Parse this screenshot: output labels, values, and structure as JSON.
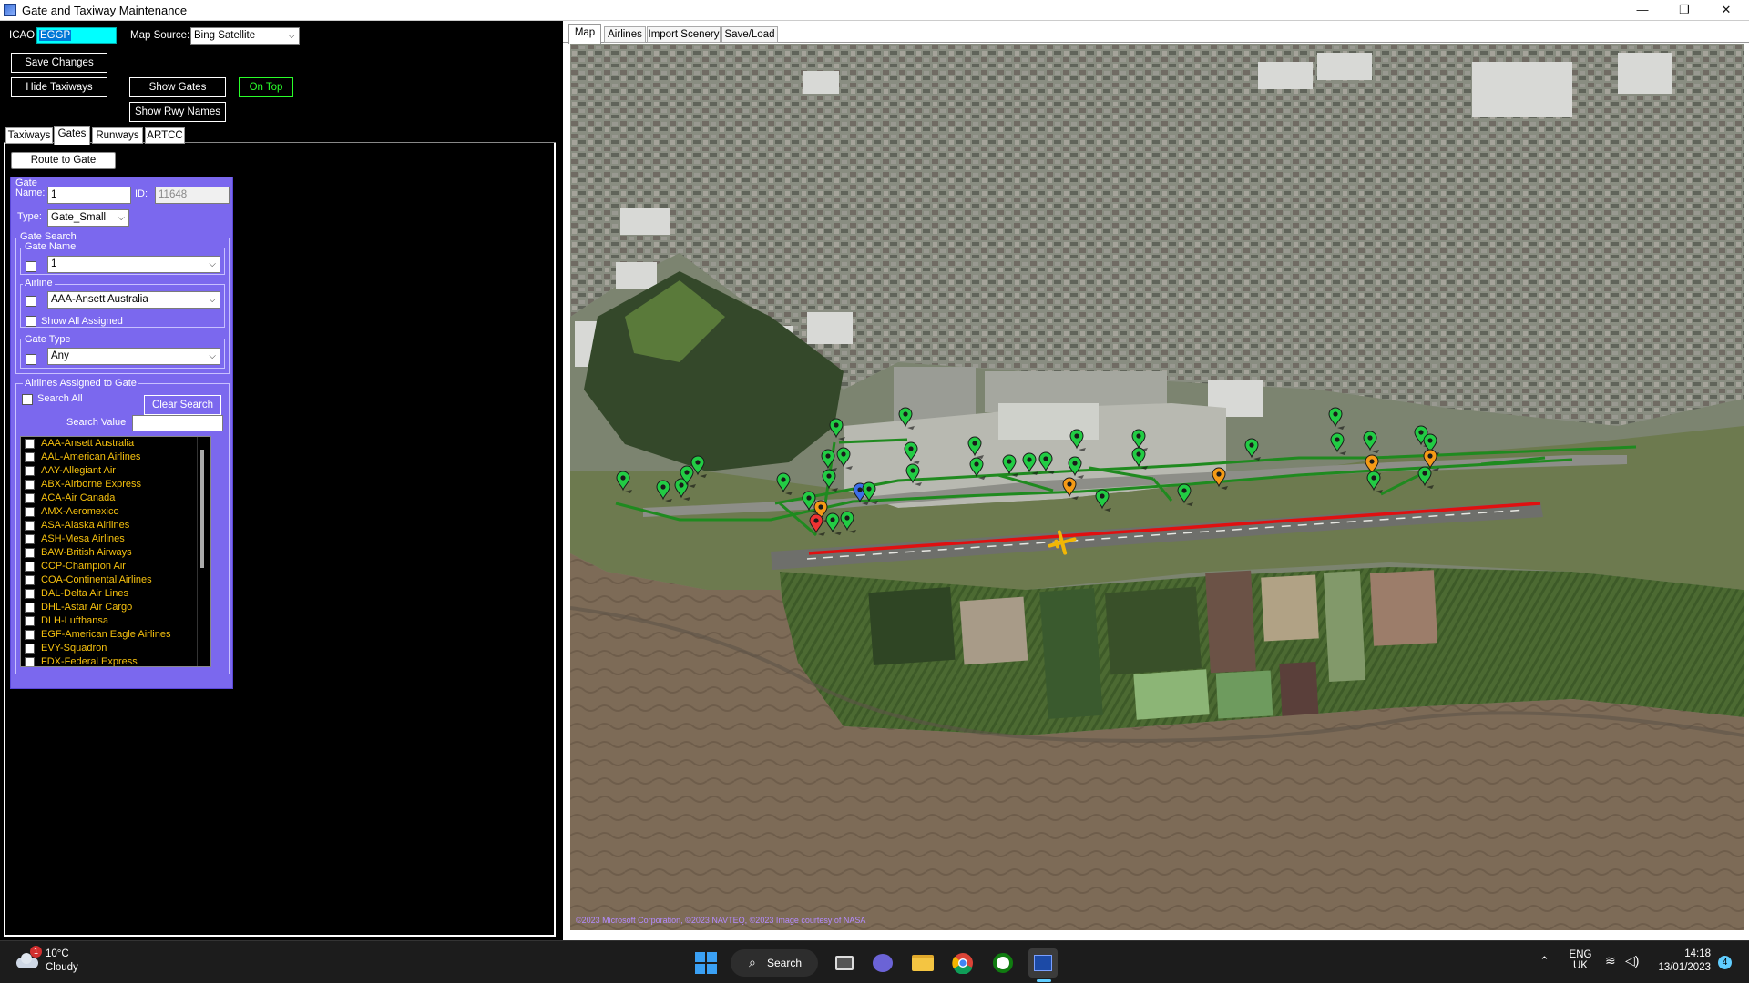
{
  "window": {
    "title": "Gate and Taxiway Maintenance",
    "controls": [
      "—",
      "❐",
      "✕"
    ]
  },
  "toolbar": {
    "icao_label": "ICAO:",
    "icao_value": "EGGP",
    "map_source_label": "Map Source:",
    "map_source_value": "Bing Satellite",
    "save_changes": "Save Changes",
    "hide_taxiways": "Hide Taxiways",
    "show_gates": "Show Gates",
    "on_top": "On Top",
    "show_rwy_names": "Show Rwy Names"
  },
  "left_tabs": [
    "Taxiways",
    "Gates",
    "Runways",
    "ARTCC"
  ],
  "left_active_tab": "Gates",
  "route_to_gate": "Route to Gate",
  "gate": {
    "group_label": "Gate",
    "name_label": "Name:",
    "name_value": "1",
    "id_label": "ID:",
    "id_value": "11648",
    "type_label": "Type:",
    "type_value": "Gate_Small"
  },
  "gate_search": {
    "group_label": "Gate Search",
    "gate_name_label": "Gate Name",
    "gate_name_value": "1",
    "airline_label": "Airline",
    "airline_value": "AAA-Ansett Australia",
    "show_all_assigned": "Show All Assigned",
    "gate_type_label": "Gate Type",
    "gate_type_value": "Any"
  },
  "airlines_assigned": {
    "group_label": "Airlines Assigned to Gate",
    "search_all": "Search All",
    "clear_search": "Clear Search",
    "search_value_label": "Search Value",
    "search_value": "",
    "items": [
      "AAA-Ansett Australia",
      "AAL-American Airlines",
      "AAY-Allegiant Air",
      "ABX-Airborne Express",
      "ACA-Air Canada",
      "AMX-Aeromexico",
      "ASA-Alaska Airlines",
      "ASH-Mesa Airlines",
      "BAW-British Airways",
      "CCP-Champion Air",
      "COA-Continental Airlines",
      "DAL-Delta Air Lines",
      "DHL-Astar Air Cargo",
      "DLH-Lufthansa",
      "EGF-American Eagle Airlines",
      "EVY-Squadron",
      "FDX-Federal Express"
    ]
  },
  "right_tabs": [
    "Map",
    "Airlines",
    "Import Scenery",
    "Save/Load"
  ],
  "right_active_tab": "Map",
  "map": {
    "copyright": "©2023 Microsoft Corporation, ©2023 NAVTEQ, ©2023 Image courtesy of NASA",
    "colors": {
      "taxiway": "#1f8a1f",
      "runway_route": "#e01010",
      "marker_green": "#22cc44",
      "marker_orange": "#f59a16",
      "marker_blue": "#3d6fe8",
      "marker_red": "#ee3333",
      "aircraft": "#f2b705"
    }
  },
  "taskbar": {
    "weather_temp": "10°C",
    "weather_desc": "Cloudy",
    "weather_badge": "1",
    "search_label": "Search",
    "lang": "ENG",
    "region": "UK",
    "time": "14:18",
    "date": "13/01/2023",
    "notification_count": "4"
  }
}
